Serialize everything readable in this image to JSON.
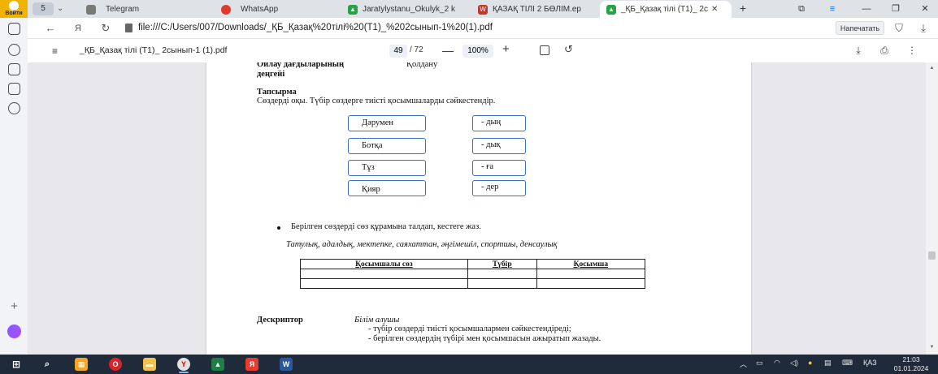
{
  "browser": {
    "profile_label": "Войти",
    "tab_group_count": "5",
    "tabs": [
      {
        "label": "Telegram",
        "icon": "document-icon",
        "active": false
      },
      {
        "label": "WhatsApp",
        "icon": "record-icon",
        "active": false
      },
      {
        "label": "Jaratylystanu_Okulyk_2 k",
        "icon": "drive-icon",
        "active": false
      },
      {
        "label": "ҚАЗАҚ ТІЛІ 2 БӨЛІМ.ep",
        "icon": "word-icon",
        "active": false
      },
      {
        "label": "_ҚБ_Қазақ тілі (Т1)_ 2с",
        "icon": "drive-icon",
        "active": true
      }
    ],
    "url": "file:///C:/Users/007/Downloads/_ҚБ_Қазақ%20тілі%20(Т1)_%202сынып-1%20(1).pdf",
    "print_label": "Напечатать"
  },
  "pdf_toolbar": {
    "title": "_ҚБ_Қазақ тілі (Т1)_ 2сынып-1 (1).pdf",
    "page_current": "49",
    "page_total": "/ 72",
    "zoom": "100%"
  },
  "document": {
    "level_label_line1": "Ойлау дағдыларының",
    "level_label_line2": "деңгейі",
    "level_value": "Қолдану",
    "task_title": "Тапсырма",
    "task_text": "Сөздерді оқы. Түбір сөздерге  тиісті қосымшаларды сәйкестендір.",
    "words": [
      "Дәрумен",
      "Ботқа",
      "Тұз",
      "Қияр"
    ],
    "suffixes": [
      "- дың",
      "- дық",
      "- ға",
      "- дер"
    ],
    "bullet_text": "Берілген сөздерді  сөз құрамына талдап,  кестеге жаз.",
    "example_words": "Татулық, адалдық, мектепке, саяхаттан, әңгімешіл, спортшы, денсаулық",
    "table_headers": [
      "Қосымшалы сөз",
      "Түбір",
      "Қосымша"
    ],
    "table_rows": 2,
    "descriptor_label": "Дескриптор",
    "descriptor_who": "Білім алушы",
    "descriptor_items": [
      "- түбір сөздерді тиісті қосымшалармен сәйкестендіреді;",
      "- берілген сөздердің түбірі мен қосымшасын ажыратып жазады."
    ]
  },
  "taskbar": {
    "language": "ҚАЗ",
    "time": "21:03",
    "date": "01.01.2024"
  },
  "colors": {
    "accent_blue": "#3a6fc2",
    "taskbar_bg": "#1f2a3a",
    "profile_yellow": "#f0b400"
  }
}
